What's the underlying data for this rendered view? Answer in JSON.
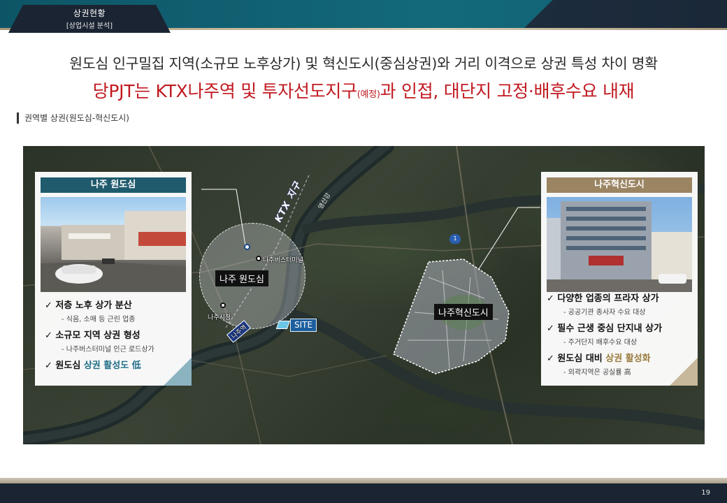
{
  "header": {
    "section_title": "상권현황",
    "section_subtitle": "[상업시설 분석]"
  },
  "headline": {
    "line1": "원도심 인구밀집 지역(소규모 노후상가) 및 혁신도시(중심상권)와 거리 이격으로 상권 특성 차이 명확",
    "line2_part1": "당PJT는 KTX나주역 및 투자선도지구",
    "line2_small": "(예정)",
    "line2_part2": "과 인접, 대단지 고정·배후수요 내재"
  },
  "sub_label": "권역별 상권(원도심-혁신도시)",
  "map": {
    "river_label": "영산강",
    "ktx_label": "KTX 지구",
    "road_number": "1",
    "bus_terminal_label": "나주버스터미널",
    "city_hall_label": "나주시청",
    "station_label": "나주역",
    "old_town_zone": "나주 원도심",
    "innovation_zone": "나주혁신도시",
    "site_label": "SITE"
  },
  "left_card": {
    "title": "나주 원도심",
    "bullets": [
      {
        "main": "저층 노후 상가 분산",
        "sub": "- 식음, 소매 등 근린 업종"
      },
      {
        "main": "소규모 지역 상권 형성",
        "sub": "- 나주버스터미널 인근 로드상가"
      }
    ],
    "last_bullet_prefix": "원도심 ",
    "last_bullet_highlight": "상권 활성도 低"
  },
  "right_card": {
    "title": "나주혁신도시",
    "bullets": [
      {
        "main": "다양한 업종의 프라자 상가",
        "sub": "- 공공기관 종사자 수요 대상"
      },
      {
        "main": "필수 근생 중심 단지내 상가",
        "sub": "- 주거단지 배후수요 대상"
      }
    ],
    "last_bullet_prefix": "원도심 대비 ",
    "last_bullet_highlight": "상권 활성화",
    "last_bullet_sub": "- 외곽지역은 공실률 高"
  },
  "footer": {
    "page_number": "19"
  }
}
